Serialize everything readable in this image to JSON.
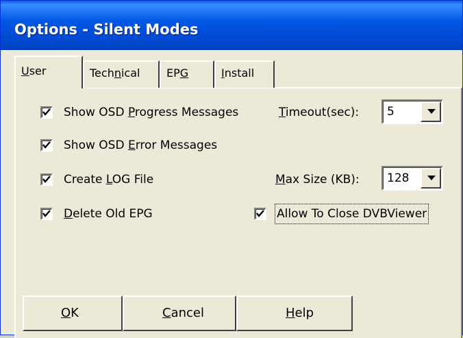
{
  "window": {
    "title": "Options - Silent Modes"
  },
  "tabs": [
    {
      "label": "User",
      "mnemonic": "U",
      "rest": "ser",
      "active": true
    },
    {
      "label": "Technical",
      "pre": "Tech",
      "mnemonic": "n",
      "rest": "ical"
    },
    {
      "label": "EPG",
      "pre": "EP",
      "mnemonic": "G",
      "rest": ""
    },
    {
      "label": "Install",
      "pre": "",
      "mnemonic": "I",
      "rest": "nstall"
    }
  ],
  "options": {
    "osd_progress": {
      "pre": "Show OSD ",
      "mnemonic": "P",
      "rest": "rogress Messages",
      "checked": true
    },
    "osd_error": {
      "pre": "Show OSD ",
      "mnemonic": "E",
      "rest": "rror Messages",
      "checked": true
    },
    "create_log": {
      "pre": "Create ",
      "mnemonic": "L",
      "rest": "OG File",
      "checked": true
    },
    "delete_epg": {
      "pre": "",
      "mnemonic": "D",
      "rest": "elete Old EPG",
      "checked": true
    },
    "allow_close": {
      "label": "Allow To Close DVBViewer",
      "checked": true
    }
  },
  "timeout": {
    "pre": "",
    "mnemonic": "T",
    "rest": "imeout(sec):",
    "value": "5"
  },
  "maxsize": {
    "pre": "",
    "mnemonic": "M",
    "rest": "ax Size (KB):",
    "value": "128"
  },
  "buttons": {
    "ok": {
      "mnemonic": "O",
      "rest": "K"
    },
    "cancel": {
      "mnemonic": "C",
      "rest": "ancel"
    },
    "help": {
      "mnemonic": "H",
      "rest": "elp"
    }
  }
}
